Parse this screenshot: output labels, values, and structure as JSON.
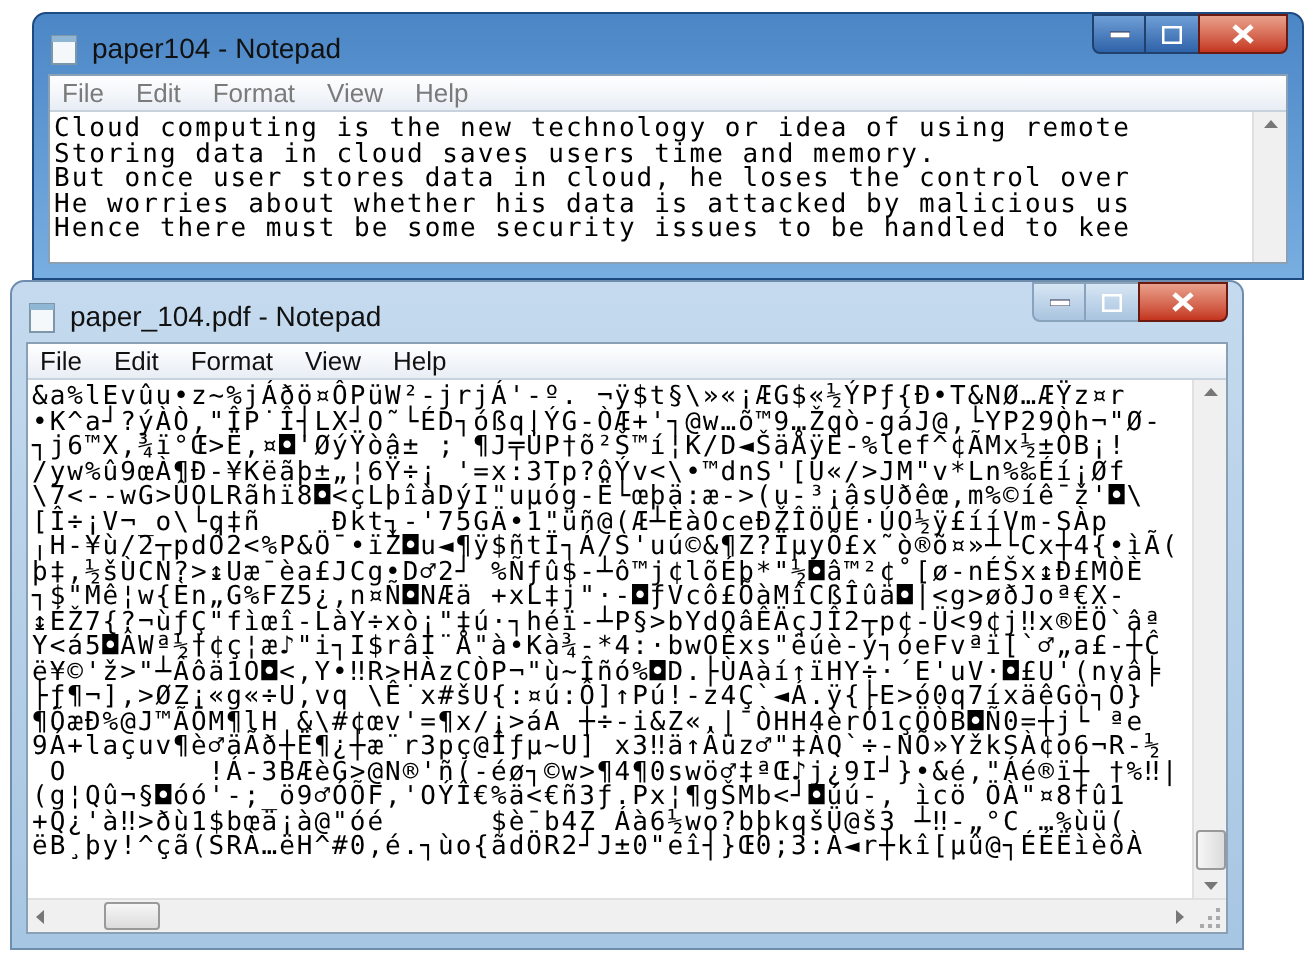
{
  "windows": [
    {
      "title": "paper104 - Notepad",
      "active": true,
      "menu": [
        "File",
        "Edit",
        "Format",
        "View",
        "Help"
      ],
      "lines": [
        "Cloud computing is the new technology or idea of using remote",
        "Storing data in cloud saves users time and memory.",
        "But once user stores data in cloud, he loses the control over",
        "He worries about whether his data is attacked by malicious us",
        "Hence there must be some security issues to be handled to kee"
      ]
    },
    {
      "title": "paper_104.pdf - Notepad",
      "active": false,
      "menu": [
        "File",
        "Edit",
        "Format",
        "View",
        "Help"
      ],
      "lines": [
        "&a%lEvûu•z~%jÁðö¤ÔPüW²-jrjÁ'-º. ¬ÿ$t§\\»«¡ÆG$«½ÝPƒ{Ð•T&NØ…ÆŸz¤r",
        "•K^a┘?ýÀÒ,\"ÎP˙Î┤LX┘O˜└ÉD┐óßq|ÝG-ÒÆ+'┐@w…õ™9…Žqò-gáJ@,└YP29Òh¬\"Ø-",
        "┐j6™X,¾ï°Œ>Ë,¤◘'ØýŸòâ± ; ¶J╤ÙP†õ²Š™í¦K/D◄ŠäÅÿÈ-%lef^¢ÃMx½±ÒB¡!",
        "/yw%û9œÀ¶Ð-¥Këãþ±„¦6Ÿ÷¡ '=x:3Tp?ôÝv<\\•™dnS'[U«/>JM\"v*Ln%‰Éí¡Øf",
        "\\7<--wG>ÛOLRãhï8◘<çLþîàDýI\"uµóg-Ë└œþä:æ->(u-³¡âsUðêœ,m%©íê¯ž'◘\\",
        "[Î÷¡V¬_o\\└q‡ñ    Ðkt┐-'75GÄ•1\"üñ@(Æ┴ÈàOceÐŽÎÖÛÉ·ÚO½ÿ£ííVm-SÀp",
        "╷H-¥ù/2┬pdÓ2<%P&Ö¯•ïŽ◘u◄¶ÿ$ñtÏ┐Á/S'uú©&¶Z?ÏµyÕ£x˜ò®õ¤»┴└Cx┼4{•ìÃ(",
        "þ‡,½šÙCN?>↨Uæ¯èa£JCg•D♂2┘ %Ñƒû$-┴ô™j¢lõÉþ*\"½◘â™²¢˚[ø-nÉŠx↨Ð£MÒÈ",
        "┐$\"Mê¦w{Èn„G%FZ5¿,n¤Ñ◘NÆä +xL‡j\"·-◘ƒVcô£ÕàMîCßÎûä◘|<g>øðJoª€X-",
        "↨ÉŽ7{?¬ùƒÇ\"fìœî-LàY÷xò¡\"‡ú·┐héï-┴P§>bYdOâÊÄçJÎ2┬p¢-Ü<9¢j‼x®ËÖ`âª",
        "Y<á5◘ÂWª½†¢ç¦æ♪\"i┐I$râI¨Å\"à•Kà¾-*4:·bwOÊxs\"ëúè-ý┐óeFvªï[`♂„a£-┼Ĉ",
        "ë¥©'ž>\"┴Âôä1O◘<,Y•‼R>HÀzCÒP¬\"ù~Îñó%◘D.├ÙAàí↑ïHY÷·´E'uV·◘£U'(nvâ╞",
        "├ƒ¶¬],>ØZ¡«g«÷U,vq \\Ê˙x#šU{:¤ú:Ô]↑Pú!-z4Ç`◄Á.ÿ{├E>ó0q7íxäêGö┐Ò}",
        "¶ÕæÐ%@J™ÃÖM¶lH &\\#¢œv'=¶x/¡>áA ┼÷-i&Z«.|¯ÒHH4èrÓ1çÖÒB◘Ñ0=┼j└ ªe",
        "9Á+laçuv¶è♂äÃð┼Ë¶¿┼æ¨r3pç@Îƒµ~U] x3‼ä↑Âüz♂\"‡ÀQ`÷-NÕ»YžkSÀ¢o6¬R-½",
        " O        !Á-3BÆèG>@N®'ñ(-éø┐©w>¶4¶0swö♂‡ªŒ♪j¿9I┘}•&é,\"Áé®ï┼ †%‼|",
        "(g¦Qû¬§◘óó'-;_ö9♂ÓÕF,'OÝÎ€%ä<€ñ3ƒ.Px¦¶gŠMb<┘◘úú-, ìcö ÖÀ\"¤8fû1",
        "+Q¿'à‼>ðù1$bœä¡à@\"óé      $è¯b4Z Áà6½wo?bþkqšÜ@š3 ┴‼-„°C …%ùü(",
        "ëB¸þy!^çã(SRÀ…ëH^#0,é.┐ùo{ãdÖR2┘J±0\"eî┤}Œ0;3:À◄r┼kî[µû@┐ÉÉËìèõÀ"
      ]
    }
  ]
}
